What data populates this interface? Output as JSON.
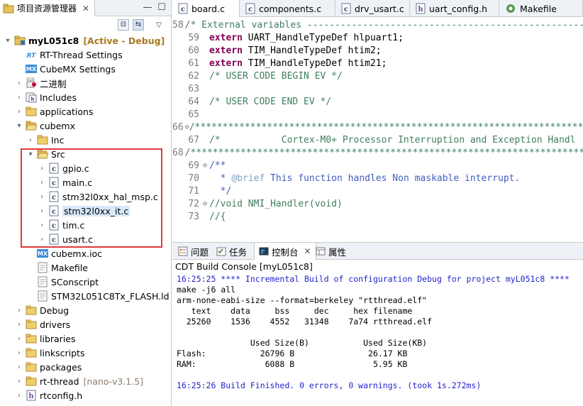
{
  "explorer": {
    "tab_label": "项目资源管理器",
    "tab_close": "✕",
    "minimize": "—",
    "maximize": "☐",
    "collapse_all": "⊟",
    "link_editor": "⇆",
    "view_menu": "▽",
    "tree": [
      {
        "label": "myL051c8",
        "deco": "[Active - Debug]",
        "deco_type": "active",
        "icon": "project-icon",
        "twisty": "▾",
        "indent": 0,
        "bold": true
      },
      {
        "label": "RT-Thread Settings",
        "icon": "rt-thread-icon",
        "twisty": "",
        "indent": 1
      },
      {
        "label": "CubeMX Settings",
        "icon": "mx-icon",
        "twisty": "",
        "indent": 1
      },
      {
        "label": "二进制",
        "icon": "binary-icon",
        "twisty": "›",
        "indent": 1
      },
      {
        "label": "Includes",
        "icon": "includes-icon",
        "twisty": "›",
        "indent": 1
      },
      {
        "label": "applications",
        "icon": "folder-icon",
        "twisty": "›",
        "indent": 1
      },
      {
        "label": "cubemx",
        "icon": "folder-open-icon",
        "twisty": "▾",
        "indent": 1
      },
      {
        "label": "Inc",
        "icon": "folder-icon",
        "twisty": "›",
        "indent": 2
      },
      {
        "label": "Src",
        "icon": "folder-open-icon",
        "twisty": "▾",
        "indent": 2
      },
      {
        "label": "gpio.c",
        "icon": "c-file-icon",
        "twisty": "›",
        "indent": 3
      },
      {
        "label": "main.c",
        "icon": "c-file-icon",
        "twisty": "›",
        "indent": 3
      },
      {
        "label": "stm32l0xx_hal_msp.c",
        "icon": "c-file-icon",
        "twisty": "›",
        "indent": 3
      },
      {
        "label": "stm32l0xx_it.c",
        "icon": "c-file-icon",
        "twisty": "›",
        "indent": 3,
        "selected": true
      },
      {
        "label": "tim.c",
        "icon": "c-file-icon",
        "twisty": "›",
        "indent": 3
      },
      {
        "label": "usart.c",
        "icon": "c-file-icon",
        "twisty": "›",
        "indent": 3
      },
      {
        "label": "cubemx.ioc",
        "icon": "mx-icon",
        "twisty": "",
        "indent": 2
      },
      {
        "label": "Makefile",
        "icon": "text-file-icon",
        "twisty": "",
        "indent": 2
      },
      {
        "label": "SConscript",
        "icon": "text-file-icon",
        "twisty": "",
        "indent": 2
      },
      {
        "label": "STM32L051C8Tx_FLASH.ld",
        "icon": "text-file-icon",
        "twisty": "",
        "indent": 2
      },
      {
        "label": "Debug",
        "icon": "folder-icon",
        "twisty": "›",
        "indent": 1
      },
      {
        "label": "drivers",
        "icon": "folder-icon",
        "twisty": "›",
        "indent": 1
      },
      {
        "label": "libraries",
        "icon": "folder-icon",
        "twisty": "›",
        "indent": 1
      },
      {
        "label": "linkscripts",
        "icon": "folder-icon",
        "twisty": "›",
        "indent": 1
      },
      {
        "label": "packages",
        "icon": "folder-icon",
        "twisty": "›",
        "indent": 1
      },
      {
        "label": "rt-thread",
        "deco": "[nano-v3.1.5]",
        "deco_type": "ver",
        "icon": "folder-icon",
        "twisty": "›",
        "indent": 1
      },
      {
        "label": "rtconfig.h",
        "icon": "h-file-icon",
        "twisty": "›",
        "indent": 1
      }
    ]
  },
  "editor": {
    "tabs": [
      {
        "label": "board.c",
        "icon": "c-file-icon"
      },
      {
        "label": "components.c",
        "icon": "c-file-icon"
      },
      {
        "label": "drv_usart.c",
        "icon": "c-file-icon"
      },
      {
        "label": "uart_config.h",
        "icon": "h-file-icon"
      },
      {
        "label": "Makefile",
        "icon": "makefile-icon"
      }
    ],
    "lines": [
      {
        "n": "58",
        "fold": "",
        "segs": [
          {
            "t": "/* External variables --------------------------------------------------------",
            "c": "src"
          }
        ]
      },
      {
        "n": "59",
        "fold": "",
        "segs": [
          {
            "t": "extern",
            "c": "kwd"
          },
          {
            "t": " UART_HandleTypeDef hlpuart1;",
            "c": "plain"
          }
        ]
      },
      {
        "n": "60",
        "fold": "",
        "segs": [
          {
            "t": "extern",
            "c": "kwd"
          },
          {
            "t": " TIM_HandleTypeDef htim2;",
            "c": "plain"
          }
        ]
      },
      {
        "n": "61",
        "fold": "",
        "segs": [
          {
            "t": "extern",
            "c": "kwd"
          },
          {
            "t": " TIM_HandleTypeDef htim21;",
            "c": "plain"
          }
        ]
      },
      {
        "n": "62",
        "fold": "",
        "segs": [
          {
            "t": "/* USER CODE BEGIN EV */",
            "c": "src"
          }
        ]
      },
      {
        "n": "63",
        "fold": "",
        "segs": []
      },
      {
        "n": "64",
        "fold": "",
        "segs": [
          {
            "t": "/* USER CODE END EV */",
            "c": "src"
          }
        ]
      },
      {
        "n": "65",
        "fold": "",
        "segs": []
      },
      {
        "n": "66",
        "fold": "⊖",
        "segs": [
          {
            "t": "/******************************************************************************",
            "c": "src"
          }
        ]
      },
      {
        "n": "67",
        "fold": "",
        "segs": [
          {
            "t": "/*           Cortex-M0+ Processor Interruption and Exception Handl",
            "c": "src"
          }
        ]
      },
      {
        "n": "68",
        "fold": "",
        "segs": [
          {
            "t": "/******************************************************************************",
            "c": "src"
          }
        ]
      },
      {
        "n": "69",
        "fold": "⊖",
        "segs": [
          {
            "t": "/**",
            "c": "doc"
          }
        ]
      },
      {
        "n": "70",
        "fold": "",
        "segs": [
          {
            "t": "  * ",
            "c": "doc"
          },
          {
            "t": "@brief",
            "c": "docgray"
          },
          {
            "t": " This function handles Non maskable interrupt.",
            "c": "doc"
          }
        ]
      },
      {
        "n": "71",
        "fold": "",
        "segs": [
          {
            "t": "  */",
            "c": "doc"
          }
        ]
      },
      {
        "n": "72",
        "fold": "⊖",
        "segs": [
          {
            "t": "//void NMI_Handler(void)",
            "c": "src"
          }
        ]
      },
      {
        "n": "73",
        "fold": "",
        "segs": [
          {
            "t": "//{",
            "c": "src"
          }
        ]
      }
    ]
  },
  "console": {
    "tabs": [
      {
        "label": "问题",
        "icon": "problems-icon",
        "active": false
      },
      {
        "label": "任务",
        "icon": "tasks-icon",
        "active": false
      },
      {
        "label": "控制台",
        "icon": "console-icon",
        "active": true,
        "close": "✕"
      },
      {
        "label": "属性",
        "icon": "properties-icon",
        "active": false
      }
    ],
    "title": "CDT Build Console [myL051c8]",
    "lines": [
      {
        "t": "16:25:25 **** Incremental Build of configuration Debug for project myL051c8 ****",
        "blue": true
      },
      {
        "t": "make -j6 all",
        "blue": false
      },
      {
        "t": "arm-none-eabi-size --format=berkeley \"rtthread.elf\"",
        "blue": false
      },
      {
        "t": "   text    data     bss     dec     hex filename",
        "blue": false
      },
      {
        "t": "  25260    1536    4552   31348    7a74 rtthread.elf",
        "blue": false
      },
      {
        "t": "",
        "blue": false
      },
      {
        "t": "               Used Size(B)           Used Size(KB)",
        "blue": false
      },
      {
        "t": "Flash:           26796 B               26.17 KB",
        "blue": false
      },
      {
        "t": "RAM:              6088 B                5.95 KB",
        "blue": false
      },
      {
        "t": "",
        "blue": false
      },
      {
        "t": "16:25:26 Build Finished. 0 errors, 0 warnings. (took 1s.272ms)",
        "blue": true
      }
    ]
  },
  "colors": {
    "highlight_box": "#e03a3a",
    "selection": "#d8e9fb",
    "active_deco": "#a6771f"
  }
}
